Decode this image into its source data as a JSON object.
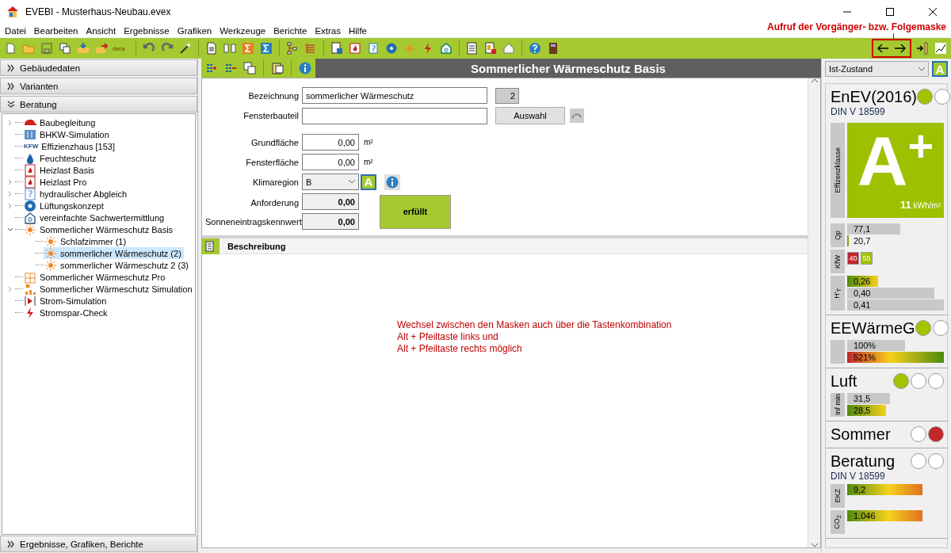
{
  "window": {
    "title": "EVEBI - Musterhaus-Neubau.evex"
  },
  "menu": [
    "Datei",
    "Bearbeiten",
    "Ansicht",
    "Ergebnisse",
    "Grafiken",
    "Werkzeuge",
    "Berichte",
    "Extras",
    "Hilfe"
  ],
  "toolbar": {
    "dena_label": "dena"
  },
  "annotation": {
    "text": "Aufruf der Vorgänger- bzw. Folgemaske"
  },
  "sidebar": {
    "sections_top": [
      {
        "label": "Gebäudedaten",
        "expanded": false
      },
      {
        "label": "Varianten",
        "expanded": false
      },
      {
        "label": "Beratung",
        "expanded": true
      }
    ],
    "tree": [
      {
        "label": "Baubegleitung",
        "expanded": false,
        "selected": false
      },
      {
        "label": "BHKW-Simulation",
        "selected": false
      },
      {
        "label": "Effizienzhaus [153]",
        "logo_text": "KFW",
        "selected": false
      },
      {
        "label": "Feuchteschutz",
        "selected": false
      },
      {
        "label": "Heizlast Basis",
        "selected": false
      },
      {
        "label": "Heizlast Pro",
        "expanded": false,
        "selected": false
      },
      {
        "label": "hydraulischer Abgleich",
        "expanded": false,
        "selected": false
      },
      {
        "label": "Lüftungskonzept",
        "expanded": false,
        "selected": false
      },
      {
        "label": "vereinfachte Sachwertermittlung",
        "selected": false
      },
      {
        "label": "Sommerlicher Wärmeschutz Basis",
        "expanded": true,
        "selected": false,
        "children": [
          {
            "label": "Schlafzimmer (1)",
            "selected": false
          },
          {
            "label": "sommerlicher Wärmeschutz (2)",
            "selected": true
          },
          {
            "label": "sommerlicher Wärmeschutz 2 (3)",
            "selected": false
          }
        ]
      },
      {
        "label": "Sommerlicher Wärmeschutz Pro",
        "selected": false
      },
      {
        "label": "Sommerlicher Wärmeschutz Simulation",
        "expanded": false,
        "selected": false
      },
      {
        "label": "Strom-Simulation",
        "selected": false
      },
      {
        "label": "Stromspar-Check",
        "selected": false
      }
    ],
    "sections_bottom": [
      {
        "label": "Ergebnisse, Grafiken, Berichte",
        "expanded": false
      }
    ]
  },
  "content": {
    "title": "Sommerlicher Wärmeschutz Basis",
    "form": {
      "bezeichnung": {
        "label": "Bezeichnung",
        "value": "sommerlicher Wärmeschutz",
        "number": "2"
      },
      "fensterbauteil": {
        "label": "Fensterbauteil",
        "button": "Auswahl"
      },
      "grundflaeche": {
        "label": "Grundfläche",
        "value": "0,00",
        "unit": "m²"
      },
      "fensterflaeche": {
        "label": "Fensterfläche",
        "value": "0,00",
        "unit": "m²"
      },
      "klimaregion": {
        "label": "Klimaregion",
        "value": "B",
        "badge": "A"
      },
      "anforderung": {
        "label": "Anforderung",
        "value": "0,00"
      },
      "sonneneintrag": {
        "label": "Sonneneintragskennwert",
        "value": "0,00"
      },
      "result": {
        "label": "erfüllt",
        "passed": true
      }
    },
    "description": {
      "title": "Beschreibung",
      "note": [
        "Wechsel zwischen den Masken auch über die Tastenkombination",
        "Alt + Pfeiltaste links und",
        "Alt + Pfeiltaste rechts möglich"
      ]
    }
  },
  "right_panel": {
    "variant": "Ist-Zustand",
    "badge": "A",
    "sections": [
      {
        "title": "EnEV(2016)",
        "subtitle": "DIN V 18599",
        "lights": [
          {
            "lit": true,
            "color": "#a2c400"
          },
          {
            "lit": false
          }
        ],
        "class_tile": {
          "side_label": "Effizenzklasse",
          "grade": "A$^{+}$",
          "value": "11",
          "unit": "kWh/m²"
        },
        "groups": [
          {
            "label": "Qp",
            "bars": [
              {
                "kind": "plain",
                "level": 0.55,
                "value": "77,1"
              },
              {
                "kind": "marker",
                "level": 0.02,
                "value": "20,7"
              }
            ]
          },
          {
            "label": "KfW",
            "bars": [
              {
                "kind": "badge",
                "value": "40",
                "color": "#c0262a"
              },
              {
                "kind": "badge",
                "value": "55",
                "color": "#a2c400"
              }
            ]
          },
          {
            "label": "H'$_{T}$",
            "bars": [
              {
                "kind": "green-yellow",
                "level": 0.32,
                "value": "0,26"
              },
              {
                "kind": "plain",
                "level": 0.9,
                "value": "0,40"
              },
              {
                "kind": "plain",
                "level": 1,
                "value": "0,41"
              }
            ]
          }
        ]
      },
      {
        "title": "EEWärmeG",
        "lights": [
          {
            "lit": true,
            "color": "#a2c400"
          },
          {
            "lit": false
          }
        ],
        "groups": [
          {
            "bars": [
              {
                "kind": "plain",
                "level": 0.6,
                "value": "100%"
              },
              {
                "kind": "red-green",
                "level": 1,
                "value": "521%"
              }
            ]
          }
        ]
      },
      {
        "title": "Luft",
        "lights": [
          {
            "lit": true,
            "color": "#a2c400"
          },
          {
            "lit": false
          },
          {
            "lit": false
          }
        ],
        "groups": [
          {
            "label": "Inf min",
            "bars": [
              {
                "kind": "plain",
                "level": 0.44,
                "value": "31,5"
              },
              {
                "kind": "green-yellow",
                "level": 0.4,
                "value": "28,5"
              }
            ]
          }
        ]
      },
      {
        "title": "Sommer",
        "lights": [
          {
            "lit": false
          },
          {
            "lit": true,
            "color": "#c0262a"
          }
        ]
      },
      {
        "title": "Beratung",
        "subtitle": "DIN V 18599",
        "lights": [
          {
            "lit": false
          },
          {
            "lit": false
          }
        ],
        "groups": [
          {
            "label": "EKZ",
            "bars": [
              {
                "kind": "green-orange",
                "level": 0.78,
                "value": "9,2"
              }
            ]
          },
          {
            "label": "CO$_{2}$",
            "bars": [
              {
                "kind": "green-orange",
                "level": 0.78,
                "value": "1.046"
              }
            ]
          }
        ]
      }
    ]
  }
}
